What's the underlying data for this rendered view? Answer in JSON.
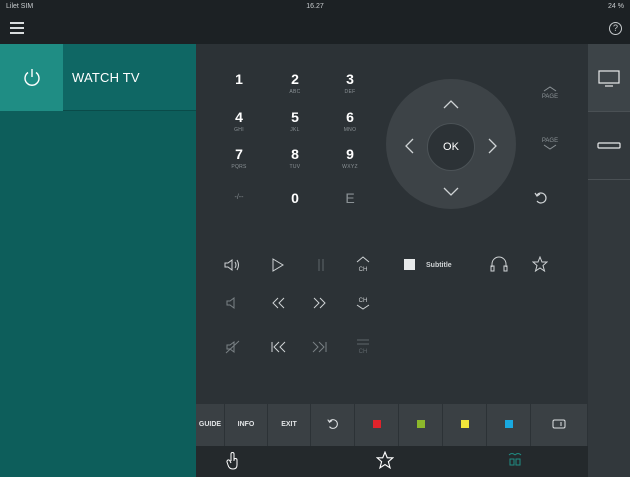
{
  "status_bar": {
    "carrier": "Lilet SIM",
    "time": "16.27",
    "battery": "24 %"
  },
  "top_bar": {
    "menu_icon": "hamburger-icon",
    "help_icon": "?"
  },
  "sidebar": {
    "source_label": "WATCH TV"
  },
  "numpad": [
    {
      "num": "1",
      "sub": ""
    },
    {
      "num": "2",
      "sub": "ABC"
    },
    {
      "num": "3",
      "sub": "DEF"
    },
    {
      "num": "4",
      "sub": "GHI"
    },
    {
      "num": "5",
      "sub": "JKL"
    },
    {
      "num": "6",
      "sub": "MNO"
    },
    {
      "num": "7",
      "sub": "PQRS"
    },
    {
      "num": "8",
      "sub": "TUV"
    },
    {
      "num": "9",
      "sub": "WXYZ"
    },
    {
      "num": "-/--",
      "sub": ""
    },
    {
      "num": "0",
      "sub": ""
    },
    {
      "num": "E",
      "sub": ""
    }
  ],
  "dpad": {
    "ok_label": "OK"
  },
  "side_buttons": {
    "page_up": "PAGE",
    "page_down": "PAGE"
  },
  "media": {
    "subtitle_label": "Subtitle",
    "ch_label": "CH"
  },
  "bottom_buttons": {
    "guide": "GUIDE",
    "info": "INFO",
    "exit": "EXIT"
  },
  "colors": {
    "red": "#e0232b",
    "green": "#8cb82b",
    "yellow": "#f2e63a",
    "blue": "#19a9e0",
    "accent": "#1f8d84",
    "sidebar": "#0d5e5b"
  },
  "tabs": [
    "touch-icon",
    "star-icon",
    "devices-icon"
  ],
  "devices": [
    "tv-icon",
    "soundbar-icon"
  ]
}
